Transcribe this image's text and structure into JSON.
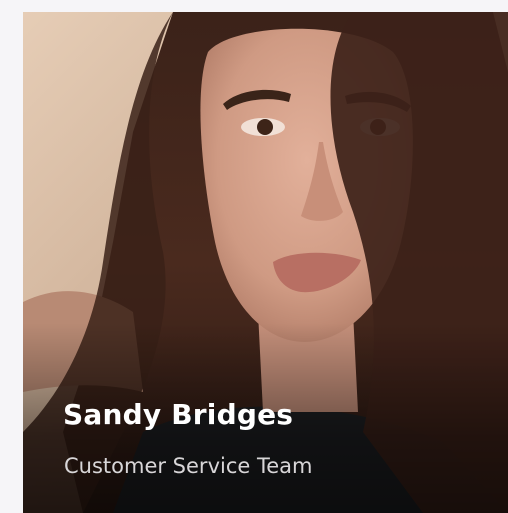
{
  "profile_card": {
    "name": "Sandy Bridges",
    "role": "Customer Service Team",
    "photo_subject": "portrait-photo"
  }
}
